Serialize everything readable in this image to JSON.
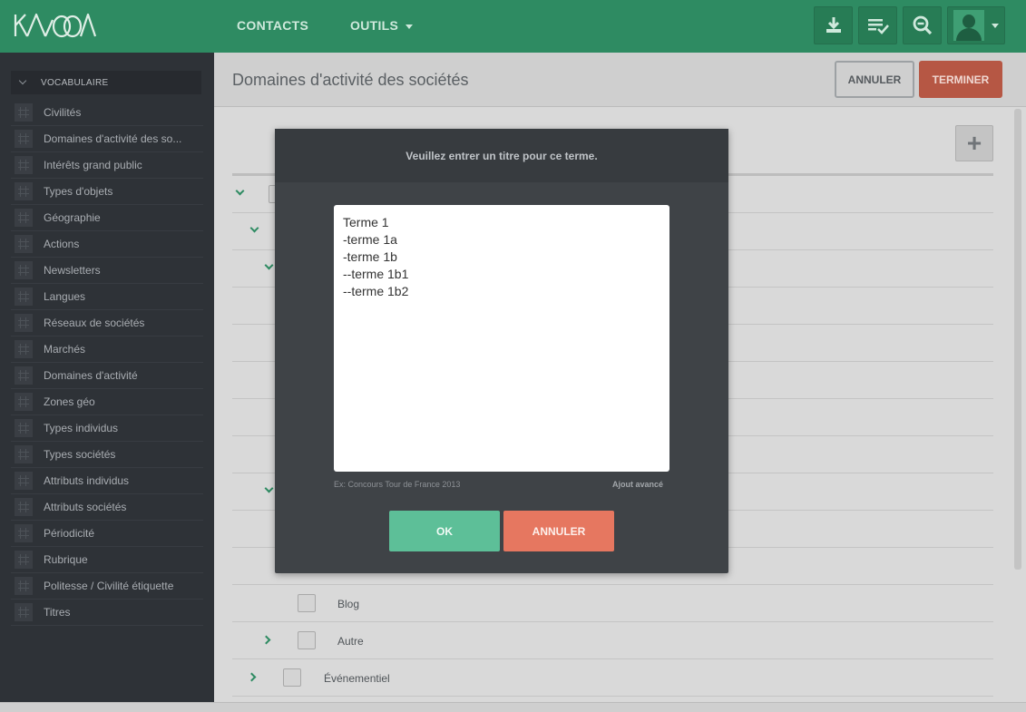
{
  "header": {
    "logo_text": "KAOOA",
    "nav": [
      {
        "label": "CONTACTS"
      },
      {
        "label": "OUTILS"
      }
    ],
    "icons": [
      "download-icon",
      "task-list-icon",
      "zoom-out-icon",
      "avatar"
    ]
  },
  "sidebar": {
    "section_label": "VOCABULAIRE",
    "items": [
      {
        "label": "Civilités"
      },
      {
        "label": "Domaines d'activité des so..."
      },
      {
        "label": "Intérêts grand public"
      },
      {
        "label": "Types d'objets"
      },
      {
        "label": "Géographie"
      },
      {
        "label": "Actions"
      },
      {
        "label": "Newsletters"
      },
      {
        "label": "Langues"
      },
      {
        "label": "Réseaux de sociétés"
      },
      {
        "label": "Marchés"
      },
      {
        "label": "Domaines d'activité"
      },
      {
        "label": "Zones géo"
      },
      {
        "label": "Types individus"
      },
      {
        "label": "Types sociétés"
      },
      {
        "label": "Attributs individus"
      },
      {
        "label": "Attributs sociétés"
      },
      {
        "label": "Périodicité"
      },
      {
        "label": "Rubrique"
      },
      {
        "label": "Politesse / Civilité étiquette"
      },
      {
        "label": "Titres"
      }
    ]
  },
  "main": {
    "title": "Domaines d'activité des sociétés",
    "annuler_label": "ANNULER",
    "terminer_label": "TERMINER",
    "add_label": "+",
    "tree_rows": [
      {
        "label": "Blog"
      },
      {
        "label": "Autre"
      },
      {
        "label": "Événementiel"
      }
    ]
  },
  "modal": {
    "title": "Veuillez entrer un titre pour ce terme.",
    "textarea_value": "Terme 1\n-terme 1a\n-terme 1b\n--terme 1b1\n--terme 1b2",
    "hint": "Ex: Concours Tour de France 2013",
    "advanced_link": "Ajout avancé",
    "ok_label": "OK",
    "cancel_label": "ANNULER"
  },
  "colors": {
    "topbar": "#2e8b62",
    "sidebar": "#2e3237",
    "ok_button": "#5dbf98",
    "cancel_button": "#e67760",
    "terminer_button": "#b65744"
  }
}
